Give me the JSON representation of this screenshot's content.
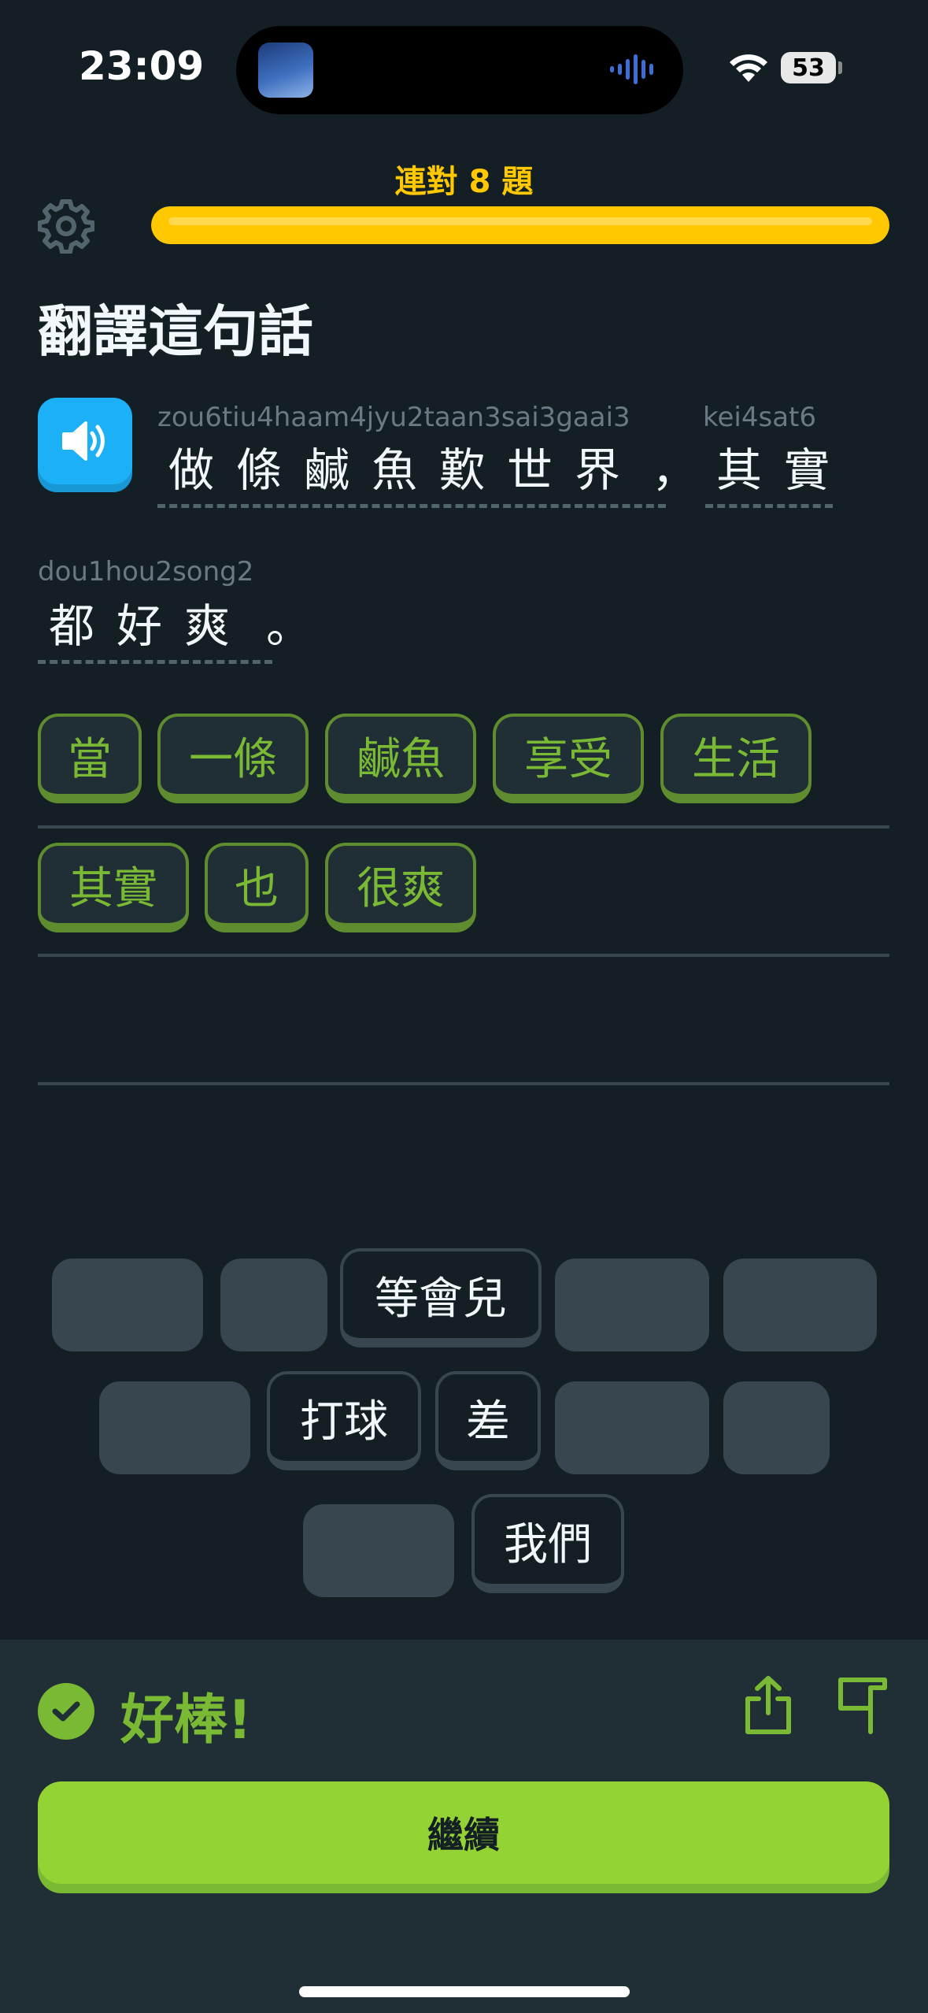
{
  "status_bar": {
    "time": "23:09",
    "battery": "53"
  },
  "header": {
    "streak": "連對 8 題",
    "progress": 1.0
  },
  "prompt": {
    "title": "翻譯這句話"
  },
  "sentence": {
    "line1": [
      {
        "romanization": "zou6tiu4haam4jyu2taan3sai3gaai3",
        "text": "做條鹹魚歎世界"
      },
      {
        "punct": "，"
      },
      {
        "romanization": "kei4sat6",
        "text": "其實"
      }
    ],
    "line2": [
      {
        "romanization": "dou1hou2song2",
        "text": "都好爽"
      },
      {
        "punct": "。"
      }
    ]
  },
  "answer": {
    "tiles": [
      "當",
      "一條",
      "鹹魚",
      "享受",
      "生活",
      "其實",
      "也",
      "很爽"
    ]
  },
  "word_bank": {
    "tiles": [
      "等會兒",
      "打球",
      "差",
      "我們"
    ]
  },
  "feedback": {
    "message": "好棒!",
    "continue_label": "繼續"
  },
  "colors": {
    "accent_green": "#79b933",
    "streak_yellow": "#ffc800",
    "speaker_blue": "#1cb0f6",
    "background": "#131f24"
  },
  "icons": [
    "settings-gear-icon",
    "speaker-icon",
    "check-icon",
    "share-icon",
    "flag-icon"
  ]
}
